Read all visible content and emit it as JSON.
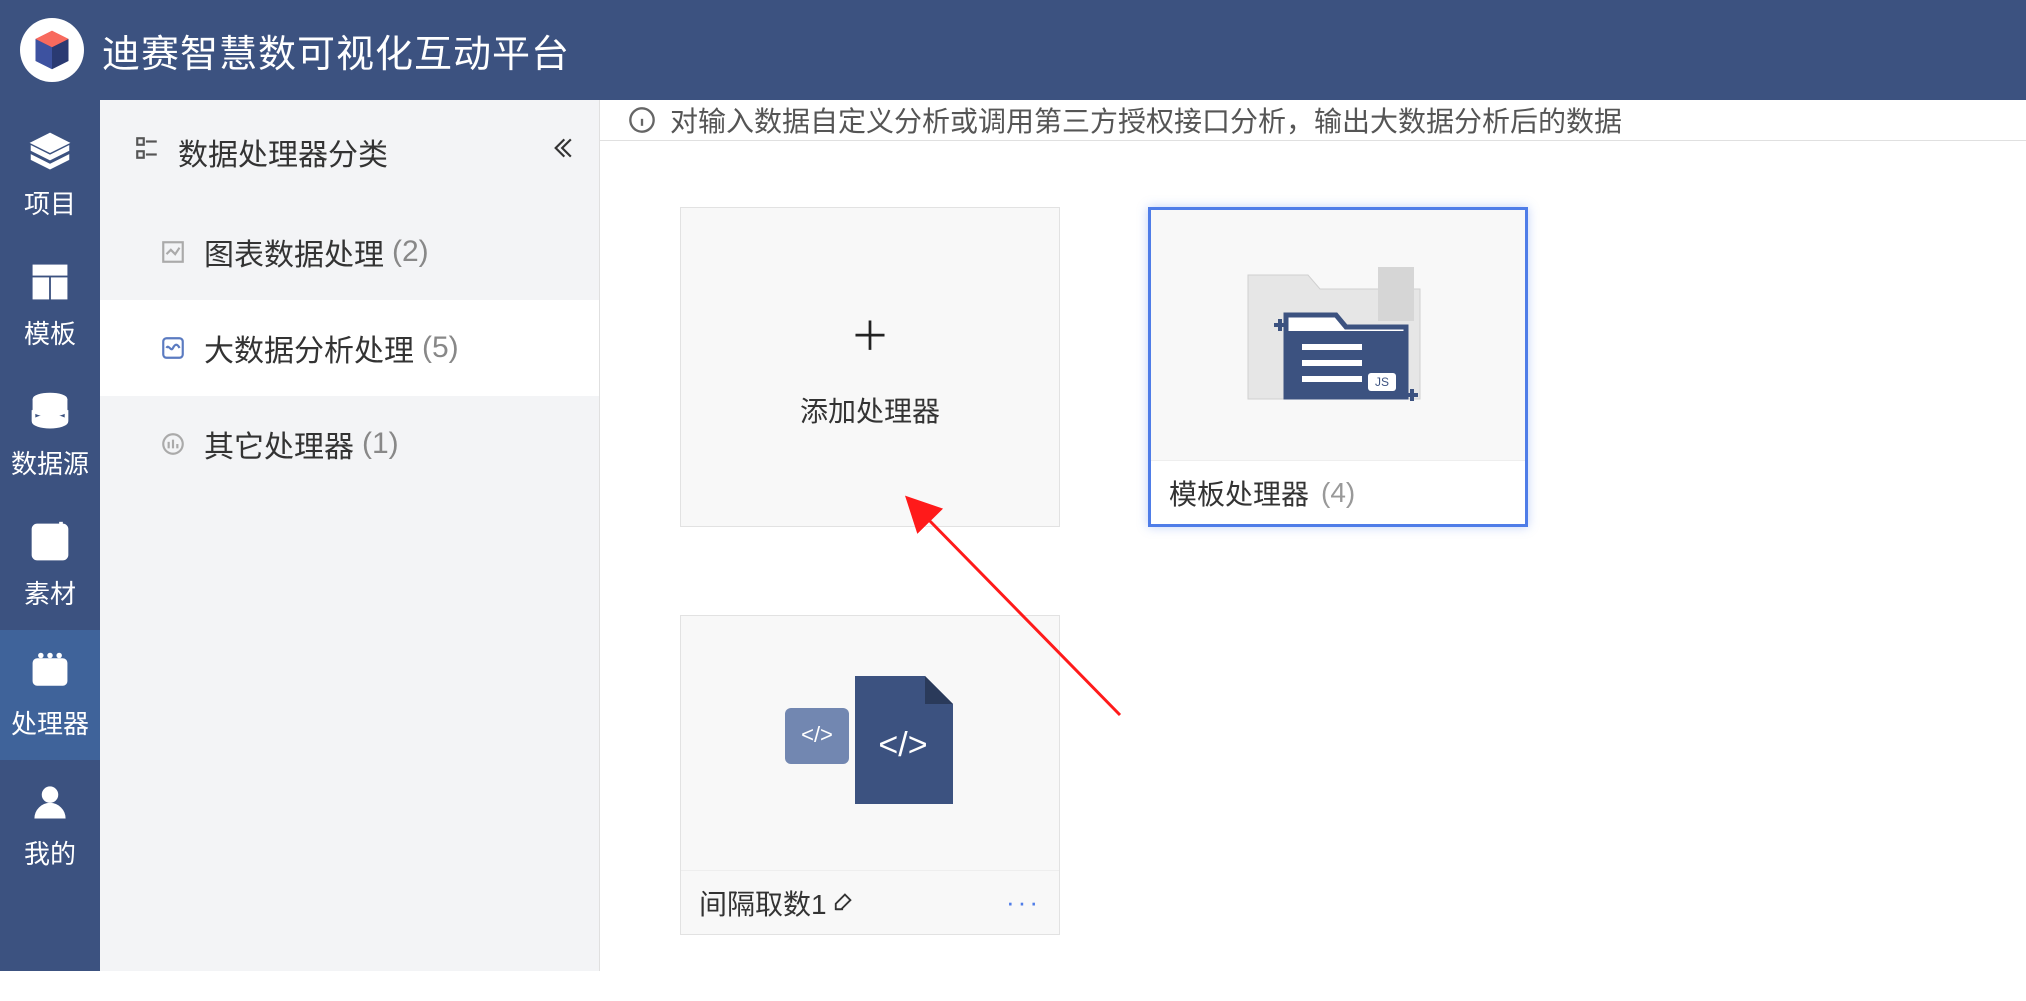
{
  "header": {
    "app_title": "迪赛智慧数可视化互动平台"
  },
  "rail": {
    "items": [
      {
        "icon": "layers-icon",
        "label": "项目"
      },
      {
        "icon": "template-icon",
        "label": "模板"
      },
      {
        "icon": "database-icon",
        "label": "数据源"
      },
      {
        "icon": "material-icon",
        "label": "素材"
      },
      {
        "icon": "processor-icon",
        "label": "处理器"
      },
      {
        "icon": "user-icon",
        "label": "我的"
      }
    ],
    "active_index": 4
  },
  "sidebar": {
    "title": "数据处理器分类",
    "items": [
      {
        "icon": "chart-icon",
        "label": "图表数据处理",
        "count": "(2)"
      },
      {
        "icon": "wave-icon",
        "label": "大数据分析处理",
        "count": "(5)"
      },
      {
        "icon": "other-icon",
        "label": "其它处理器",
        "count": "(1)"
      }
    ],
    "active_index": 1
  },
  "main": {
    "notice": "对输入数据自定义分析或调用第三方授权接口分析，输出大数据分析后的数据",
    "add_card": {
      "label": "添加处理器"
    },
    "folder_card": {
      "label": "模板处理器",
      "count": "(4)"
    },
    "item_card": {
      "name": "间隔取数1",
      "more": "···"
    }
  }
}
